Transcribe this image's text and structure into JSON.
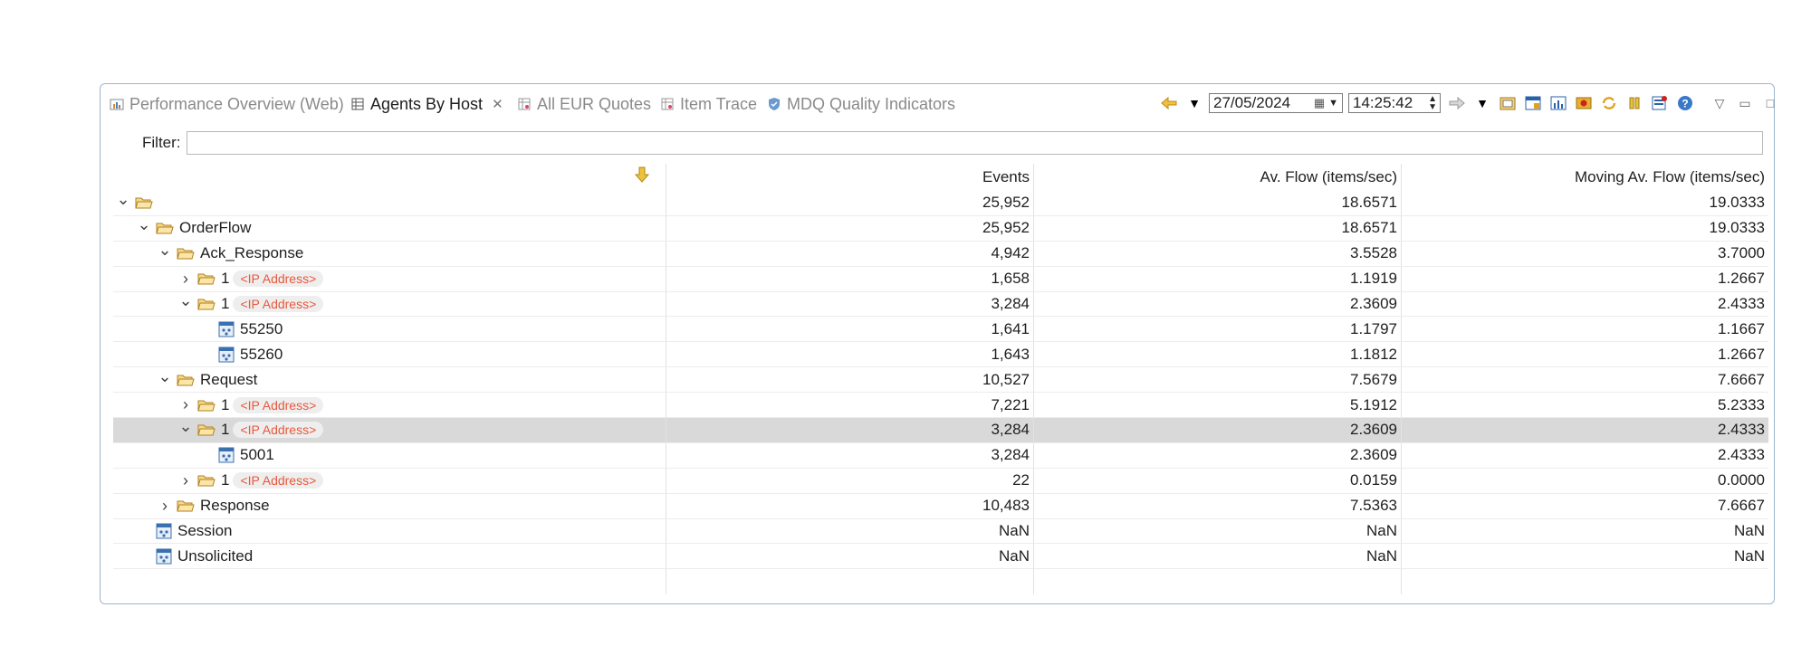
{
  "tabs": [
    {
      "label": "Performance Overview (Web)",
      "active": false,
      "icon": "chart-icon"
    },
    {
      "label": "Agents By Host",
      "active": true,
      "icon": "table-icon"
    },
    {
      "label": "All EUR Quotes",
      "active": false,
      "icon": "table-icon"
    },
    {
      "label": "Item Trace",
      "active": false,
      "icon": "table-icon"
    },
    {
      "label": "MDQ Quality Indicators",
      "active": false,
      "icon": "shield-icon"
    }
  ],
  "toolbar": {
    "date": "27/05/2024",
    "time": "14:25:42"
  },
  "filter": {
    "label": "Filter:",
    "value": ""
  },
  "columns": [
    "",
    "Events",
    "Av. Flow (items/sec)",
    "Moving Av. Flow (items/sec)"
  ],
  "rows": [
    {
      "depth": 0,
      "twisty": "expanded",
      "type": "folder",
      "label": "",
      "badge": "",
      "events": "25,952",
      "avflow": "18.6571",
      "moving": "19.0333",
      "selected": false
    },
    {
      "depth": 1,
      "twisty": "expanded",
      "type": "folder",
      "label": "OrderFlow",
      "badge": "",
      "events": "25,952",
      "avflow": "18.6571",
      "moving": "19.0333",
      "selected": false
    },
    {
      "depth": 2,
      "twisty": "expanded",
      "type": "folder",
      "label": "Ack_Response",
      "badge": "",
      "events": "4,942",
      "avflow": "3.5528",
      "moving": "3.7000",
      "selected": false
    },
    {
      "depth": 3,
      "twisty": "collapsed",
      "type": "folder",
      "label": "1",
      "badge": "<IP Address>",
      "events": "1,658",
      "avflow": "1.1919",
      "moving": "1.2667",
      "selected": false
    },
    {
      "depth": 3,
      "twisty": "expanded",
      "type": "folder",
      "label": "1",
      "badge": "<IP Address>",
      "events": "3,284",
      "avflow": "2.3609",
      "moving": "2.4333",
      "selected": false
    },
    {
      "depth": 4,
      "twisty": "none",
      "type": "agent",
      "label": "55250",
      "badge": "",
      "events": "1,641",
      "avflow": "1.1797",
      "moving": "1.1667",
      "selected": false
    },
    {
      "depth": 4,
      "twisty": "none",
      "type": "agent",
      "label": "55260",
      "badge": "",
      "events": "1,643",
      "avflow": "1.1812",
      "moving": "1.2667",
      "selected": false
    },
    {
      "depth": 2,
      "twisty": "expanded",
      "type": "folder",
      "label": "Request",
      "badge": "",
      "events": "10,527",
      "avflow": "7.5679",
      "moving": "7.6667",
      "selected": false
    },
    {
      "depth": 3,
      "twisty": "collapsed",
      "type": "folder",
      "label": "1",
      "badge": "<IP Address>",
      "events": "7,221",
      "avflow": "5.1912",
      "moving": "5.2333",
      "selected": false
    },
    {
      "depth": 3,
      "twisty": "expanded",
      "type": "folder",
      "label": "1",
      "badge": "<IP Address>",
      "events": "3,284",
      "avflow": "2.3609",
      "moving": "2.4333",
      "selected": true
    },
    {
      "depth": 4,
      "twisty": "none",
      "type": "agent",
      "label": "5001",
      "badge": "",
      "events": "3,284",
      "avflow": "2.3609",
      "moving": "2.4333",
      "selected": false
    },
    {
      "depth": 3,
      "twisty": "collapsed",
      "type": "folder",
      "label": "1",
      "badge": "<IP Address>",
      "events": "22",
      "avflow": "0.0159",
      "moving": "0.0000",
      "selected": false
    },
    {
      "depth": 2,
      "twisty": "collapsed",
      "type": "folder",
      "label": "Response",
      "badge": "",
      "events": "10,483",
      "avflow": "7.5363",
      "moving": "7.6667",
      "selected": false
    },
    {
      "depth": 1,
      "twisty": "none",
      "type": "agent",
      "label": "Session",
      "badge": "",
      "events": "NaN",
      "avflow": "NaN",
      "moving": "NaN",
      "selected": false
    },
    {
      "depth": 1,
      "twisty": "none",
      "type": "agent",
      "label": "Unsolicited",
      "badge": "",
      "events": "NaN",
      "avflow": "NaN",
      "moving": "NaN",
      "selected": false
    }
  ]
}
